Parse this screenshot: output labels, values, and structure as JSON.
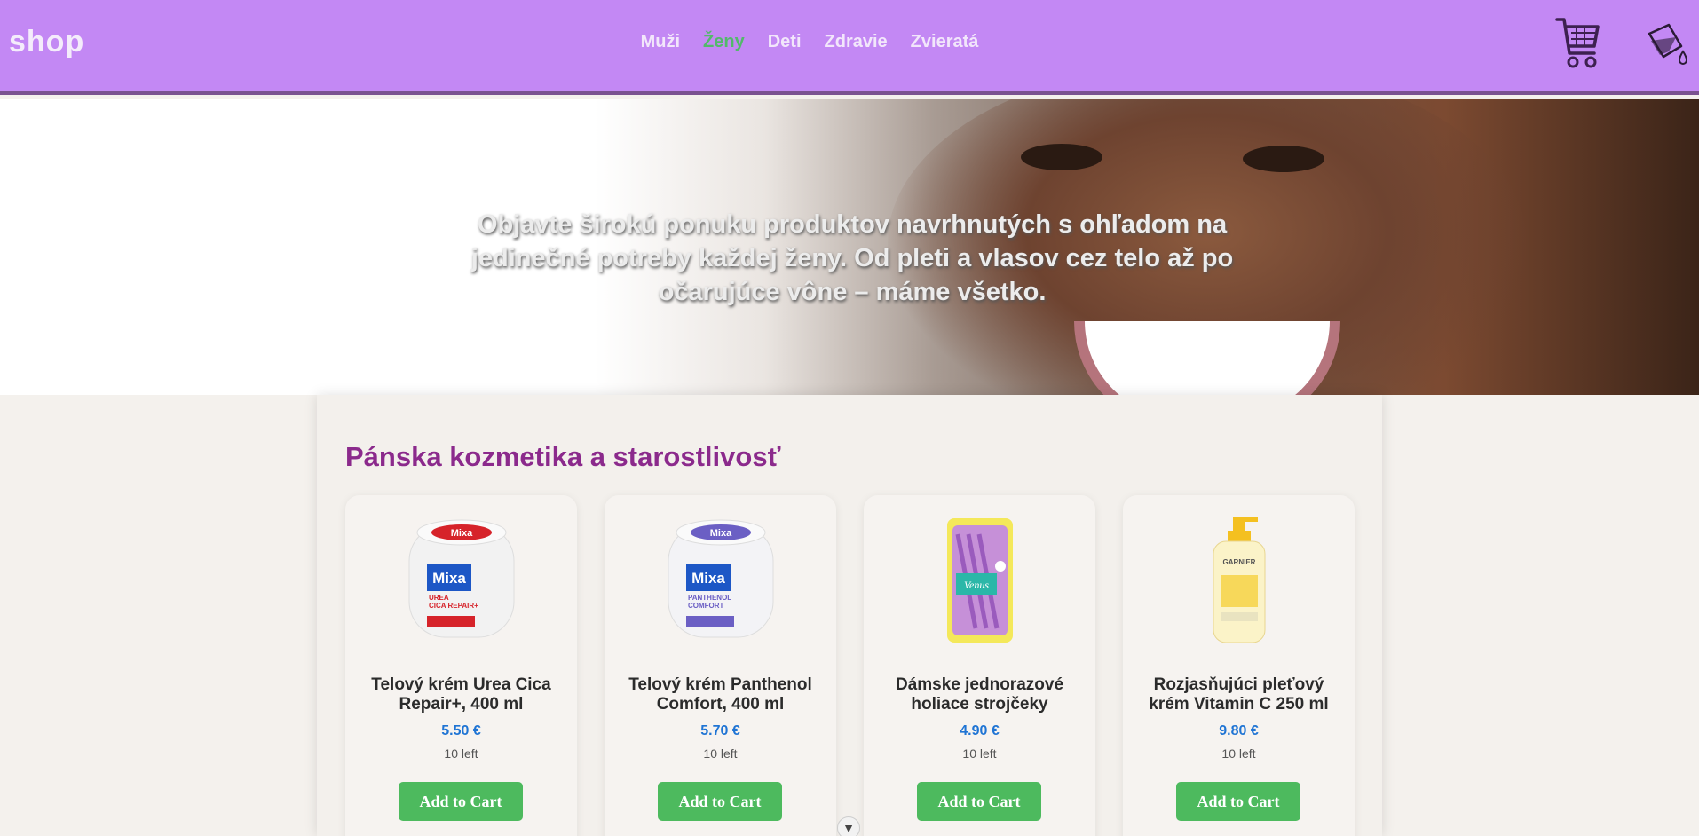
{
  "brand": {
    "logo_text": "shop"
  },
  "nav": {
    "items": [
      {
        "label": "Muži",
        "active": false
      },
      {
        "label": "Ženy",
        "active": true
      },
      {
        "label": "Deti",
        "active": false
      },
      {
        "label": "Zdravie",
        "active": false
      },
      {
        "label": "Zvieratá",
        "active": false
      }
    ]
  },
  "header_icons": {
    "cart": "cart-icon",
    "theme": "paint-bucket-icon"
  },
  "hero": {
    "text": "Objavte širokú ponuku produktov navrhnutých s ohľadom na jedinečné potreby každej ženy. Od pleti a vlasov cez telo až po očarujúce vône – máme všetko."
  },
  "section": {
    "title": "Pánska kozmetika a starostlivosť"
  },
  "products": [
    {
      "name": "Telový krém Urea Cica Repair+, 400 ml",
      "price": "5.50 €",
      "stock": "10 left",
      "button": "Add to Cart",
      "image_brand": "Mixa",
      "image_line": "UREA CICA REPAIR+",
      "accent": "#d6232a"
    },
    {
      "name": "Telový krém Panthenol Comfort, 400 ml",
      "price": "5.70 €",
      "stock": "10 left",
      "button": "Add to Cart",
      "image_brand": "Mixa",
      "image_line": "PANTHENOL COMFORT",
      "accent": "#6b5fc4"
    },
    {
      "name": "Dámske jednorazové holiace strojčeky",
      "price": "4.90 €",
      "stock": "10 left",
      "button": "Add to Cart",
      "image_brand": "Venus",
      "image_line": "",
      "accent": "#a56cc7"
    },
    {
      "name": "Rozjasňujúci pleťový krém Vitamin C 250 ml",
      "price": "9.80 €",
      "stock": "10 left",
      "button": "Add to Cart",
      "image_brand": "GARNIER",
      "image_line": "",
      "accent": "#f4c020"
    }
  ],
  "colors": {
    "header": "#c388f4",
    "active_nav": "#52b96a",
    "title": "#8b2a8c",
    "price": "#1f74d4",
    "button": "#4dba5e"
  }
}
